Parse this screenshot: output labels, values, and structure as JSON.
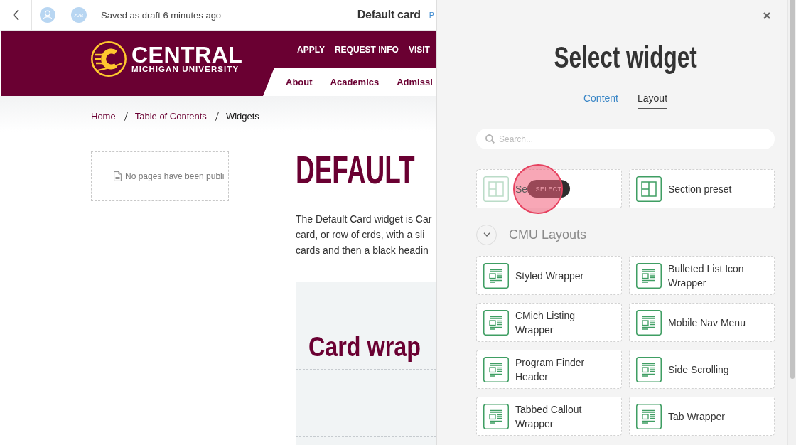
{
  "editor_bar": {
    "collaborator_initials": "A/B",
    "status": "Saved as draft 6 minutes ago",
    "title": "Default card",
    "link": "P"
  },
  "site_header": {
    "wordmark": "CENTRAL",
    "subtitle": "MICHIGAN UNIVERSITY",
    "utility_nav": [
      "APPLY",
      "REQUEST INFO",
      "VISIT"
    ],
    "main_nav": [
      "About",
      "Academics",
      "Admissi"
    ]
  },
  "breadcrumb": [
    {
      "label": "Home",
      "current": false
    },
    {
      "label": "Table of Contents",
      "current": false
    },
    {
      "label": "Widgets",
      "current": true
    }
  ],
  "sidebar": {
    "message": "No pages have been publi"
  },
  "content": {
    "heading": "DEFAULT",
    "paragraph": [
      "The Default Card widget is Car",
      "card, or row of crds, with a sli",
      "cards and then a black headin"
    ],
    "card_wrapper": {
      "heading": "Card wrap"
    }
  },
  "widget_panel": {
    "title": "Select widget",
    "tabs": [
      {
        "label": "Content",
        "selected": false
      },
      {
        "label": "Layout",
        "selected": true
      }
    ],
    "search": {
      "placeholder": "Search..."
    },
    "widgets": [
      {
        "label": "Se",
        "kind": "section",
        "hovered": true,
        "clicked": true,
        "action": "SELECT"
      },
      {
        "label": "Section preset",
        "kind": "section",
        "hovered": false,
        "clicked": false
      }
    ],
    "groups": [
      {
        "title": "CMU Layouts",
        "expanded": true,
        "widgets": [
          {
            "label": "Styled Wrapper",
            "kind": "wrapper"
          },
          {
            "label": "Bulleted List Icon Wrapper",
            "kind": "wrapper"
          },
          {
            "label": "CMich Listing Wrapper",
            "kind": "wrapper"
          },
          {
            "label": "Mobile Nav Menu",
            "kind": "wrapper"
          },
          {
            "label": "Program Finder Header",
            "kind": "wrapper"
          },
          {
            "label": "Side Scrolling",
            "kind": "wrapper"
          },
          {
            "label": "Tabbed Callout Wrapper",
            "kind": "wrapper"
          },
          {
            "label": "Tab Wrapper",
            "kind": "wrapper"
          }
        ]
      }
    ]
  }
}
